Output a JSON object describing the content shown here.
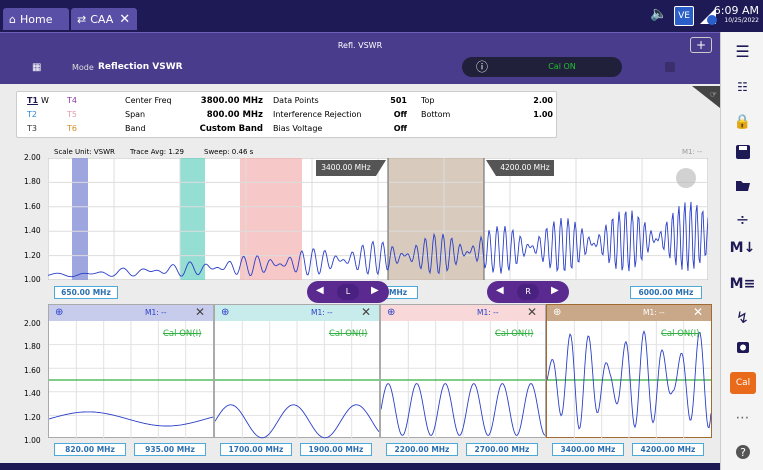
{
  "topbar": {
    "home_tab": "Home",
    "caa_tab": "CAA",
    "time": "6:09 AM",
    "date": "10/25/2022"
  },
  "modebar": {
    "title": "Refl. VSWR",
    "mode_label": "Mode",
    "mode_value": "Reflection VSWR",
    "cal_status": "Cal ON"
  },
  "params": {
    "traces": [
      "T1",
      "W",
      "T4",
      "T2",
      "T5",
      "T3",
      "T6"
    ],
    "center_freq_label": "Center Freq",
    "center_freq_value": "3800.00 MHz",
    "span_label": "Span",
    "span_value": "800.00 MHz",
    "band_label": "Band",
    "band_value": "Custom Band",
    "data_points_label": "Data Points",
    "data_points_value": "501",
    "interference_label": "Interference Rejection",
    "interference_value": "Off",
    "bias_label": "Bias Voltage",
    "bias_value": "Off",
    "top_label": "Top",
    "top_value": "2.00",
    "bottom_label": "Bottom",
    "bottom_value": "1.00"
  },
  "chart": {
    "scale_unit": "Scale Unit: VSWR",
    "trace_avg": "Trace Avg: 1.29",
    "sweep": "Sweep: 0.46 s",
    "marker_status": "M1: --",
    "start_freq": "650.00 MHz",
    "stop_freq": "6000.00 MHz",
    "mhz_partial": "MHz",
    "marker_l_freq": "3400.00 MHz",
    "marker_r_freq": "4200.00 MHz",
    "nav_l": "L",
    "nav_r": "R",
    "y_ticks": [
      "2.00",
      "1.80",
      "1.60",
      "1.40",
      "1.20",
      "1.00"
    ]
  },
  "mini_charts": [
    {
      "marker": "M1: --",
      "cal": "Cal ON(I)",
      "start": "820.00 MHz",
      "stop": "935.00 MHz"
    },
    {
      "marker": "M1: --",
      "cal": "Cal ON(I)",
      "start": "1700.00 MHz",
      "stop": "1900.00 MHz"
    },
    {
      "marker": "M1: --",
      "cal": "Cal ON(I)",
      "start": "2200.00 MHz",
      "stop": "2700.00 MHz"
    },
    {
      "marker": "M1: --",
      "cal": "Cal ON(I)",
      "start": "3400.00 MHz",
      "stop": "4200.00 MHz"
    }
  ],
  "mini_y_ticks": [
    "2.00",
    "1.80",
    "1.60",
    "1.40",
    "1.20",
    "1.00"
  ],
  "sidebar": {
    "cal_label": "Cal"
  },
  "colors": {
    "trace": "#2a3fc8",
    "limit": "#30b040",
    "band1": "#8c96d8",
    "band2": "#66d0c0",
    "band3": "#f4b0b0",
    "band4": "#c8b4a0",
    "hdr1": "#c8ccec",
    "hdr2": "#c8ecec",
    "hdr3": "#f8d8d8",
    "hdr4": "#c8a888"
  }
}
